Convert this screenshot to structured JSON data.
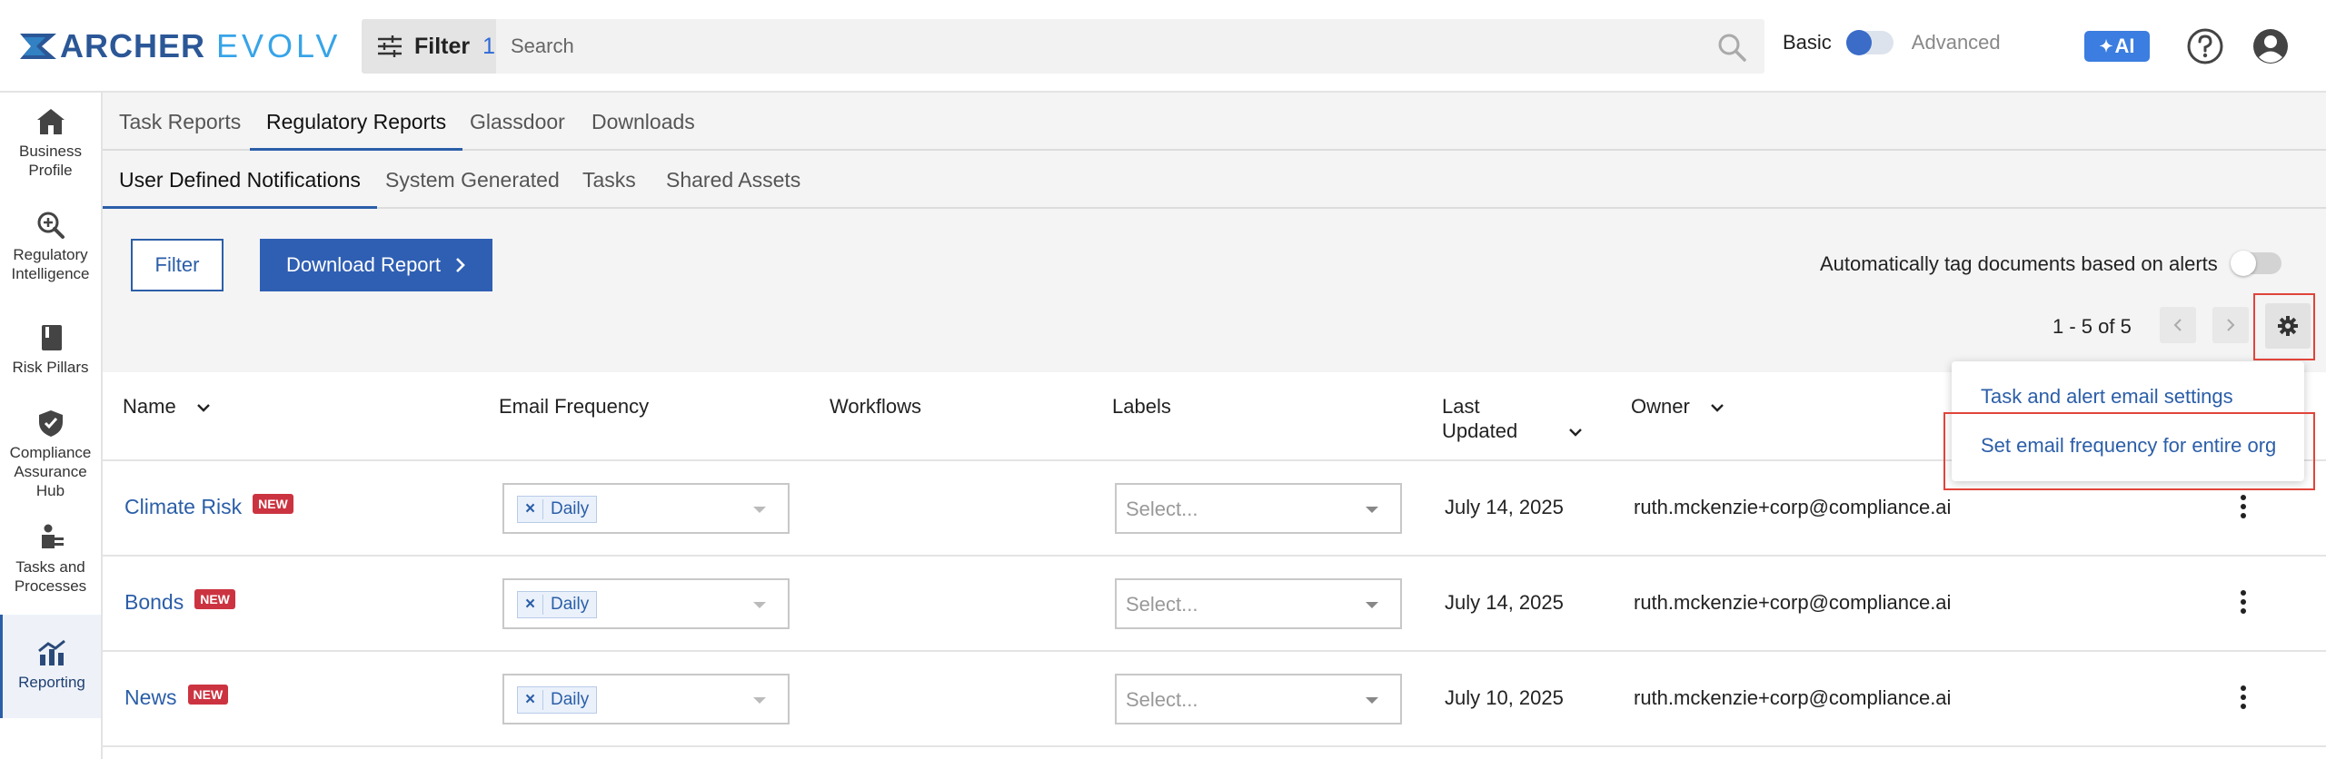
{
  "header": {
    "logo_primary": "ARCHER",
    "logo_secondary": "EVOLV",
    "filter_label": "Filter",
    "filter_count": "1",
    "search_placeholder": "Search",
    "mode_basic": "Basic",
    "mode_advanced": "Advanced",
    "ai_label": "AI"
  },
  "sidebar": {
    "items": [
      {
        "label": "Business Profile",
        "icon": "home-icon"
      },
      {
        "label": "Regulatory Intelligence",
        "icon": "magnify-plus-icon"
      },
      {
        "label": "Risk Pillars",
        "icon": "book-icon"
      },
      {
        "label": "Compliance Assurance Hub",
        "icon": "shield-check-icon"
      },
      {
        "label": "Tasks and Processes",
        "icon": "person-tasks-icon"
      },
      {
        "label": "Reporting",
        "icon": "chart-icon",
        "active": true
      }
    ]
  },
  "tabs_primary": [
    {
      "label": "Task Reports"
    },
    {
      "label": "Regulatory Reports",
      "active": true
    },
    {
      "label": "Glassdoor"
    },
    {
      "label": "Downloads"
    }
  ],
  "tabs_secondary": [
    {
      "label": "User Defined Notifications",
      "active": true
    },
    {
      "label": "System Generated"
    },
    {
      "label": "Tasks"
    },
    {
      "label": "Shared Assets"
    }
  ],
  "toolbar": {
    "filter_label": "Filter",
    "download_label": "Download Report",
    "autotag_label": "Automatically tag documents based on alerts",
    "pager_text": "1 - 5 of 5"
  },
  "table": {
    "columns": {
      "name": "Name",
      "email_frequency": "Email Frequency",
      "workflows": "Workflows",
      "labels": "Labels",
      "last_updated_1": "Last",
      "last_updated_2": "Updated",
      "owner": "Owner"
    },
    "badge_new": "NEW",
    "label_placeholder": "Select...",
    "rows": [
      {
        "name": "Climate Risk",
        "frequency": "Daily",
        "updated": "July 14, 2025",
        "owner": "ruth.mckenzie+corp@compliance.ai"
      },
      {
        "name": "Bonds",
        "frequency": "Daily",
        "updated": "July 14, 2025",
        "owner": "ruth.mckenzie+corp@compliance.ai"
      },
      {
        "name": "News",
        "frequency": "Daily",
        "updated": "July 10, 2025",
        "owner": "ruth.mckenzie+corp@compliance.ai"
      }
    ]
  },
  "settings_menu": {
    "item_1": "Task and alert email settings",
    "item_2": "Set email frequency for entire org"
  },
  "colors": {
    "brand_blue": "#2b5ea8",
    "accent_light_blue": "#37a4e8",
    "badge_red": "#cc3340",
    "highlight_red": "#e0443a"
  }
}
